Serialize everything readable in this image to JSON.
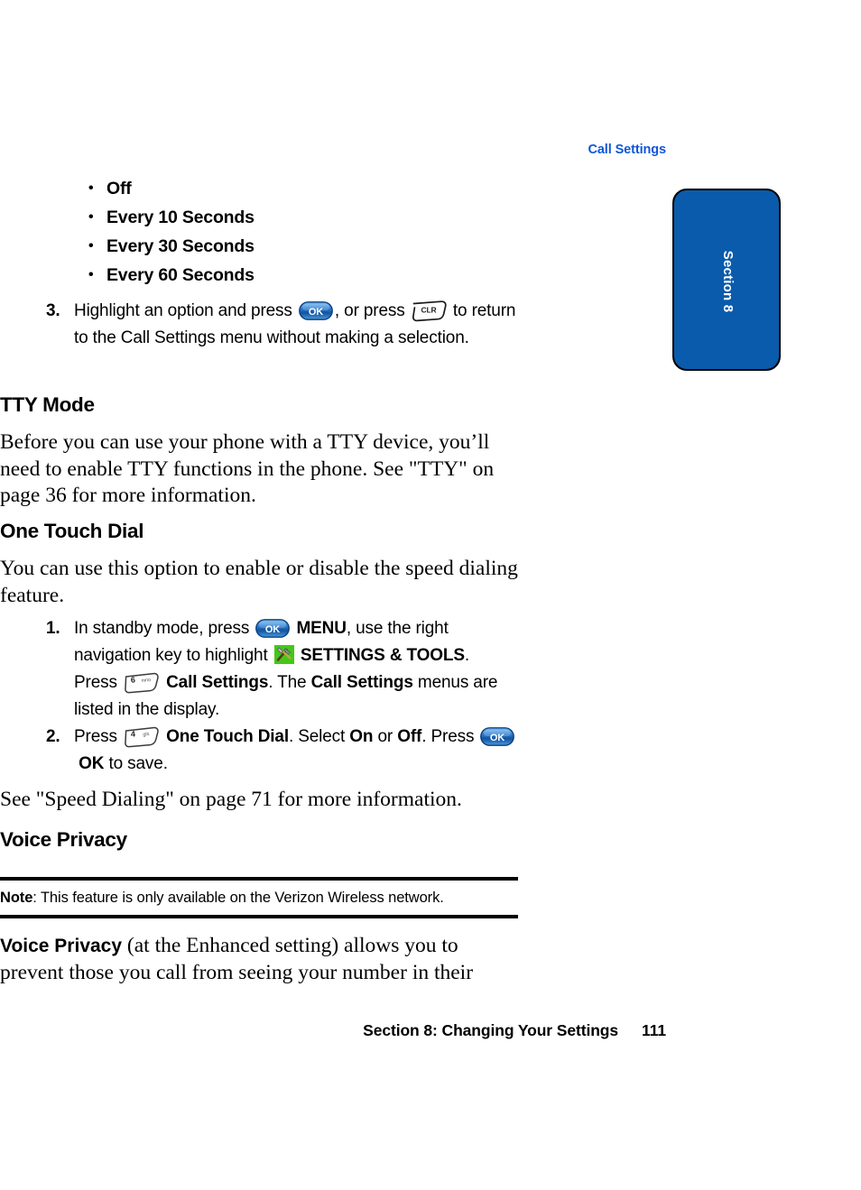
{
  "running_head": "Call Settings",
  "section_tab": {
    "label": "Section 8",
    "color": "#0a5bab"
  },
  "colors": {
    "running_head": "#0f56d8",
    "tab_blue": "#0a5bab",
    "ok_key_blue": "#1f6fd0",
    "tools_green": "#44c718"
  },
  "bullets": [
    "Off",
    "Every 10 Seconds",
    "Every 30 Seconds",
    "Every 60 Seconds"
  ],
  "step3": {
    "number": "3.",
    "t1": "Highlight an option and press",
    "t2": ", or press",
    "t3": "to return to the Call Settings menu without making a selection.",
    "ok_key_label": "OK",
    "clr_key_label": "CLR"
  },
  "tty": {
    "heading": "TTY Mode",
    "paragraph": "Before you can use your phone with a TTY device, you’ll need to enable TTY functions in the phone. See \"TTY\" on page 36 for more information."
  },
  "one_touch_dial": {
    "heading": "One Touch Dial",
    "paragraph": "You can use this option to enable or disable the speed dialing feature.",
    "step1": {
      "number": "1.",
      "t1": "In standby mode, press",
      "b1": "MENU",
      "t2": ", use the right navigation key to highlight",
      "b2": "SETTINGS & TOOLS",
      "t3": ". Press",
      "b3": "Call Settings",
      "t4": ". The",
      "b4": "Call Settings",
      "t5": "menus are listed in the display.",
      "ok_key_label": "OK",
      "num_key_digit": "6",
      "num_key_letters": "mno",
      "tools_icon_name": "settings-and-tools-icon"
    },
    "step2": {
      "number": "2.",
      "t1": "Press",
      "b1": "One Touch Dial",
      "t2": ". Select",
      "b2": "On",
      "t3": "or",
      "b3": "Off",
      "t4": ". Press",
      "b4": "OK",
      "t5": "to save.",
      "ok_key_label": "OK",
      "num_key_digit": "4",
      "num_key_letters": "ghi"
    },
    "see_also": "See \"Speed Dialing\" on page 71 for more information."
  },
  "voice_privacy": {
    "heading": "Voice Privacy",
    "note_label": "Note",
    "note_text": ": This feature is only available on the Verizon Wireless network.",
    "para_bold": "Voice Privacy",
    "para_rest": " (at the Enhanced setting) allows you to prevent those you call from seeing your number in their"
  },
  "footer": {
    "text": "Section 8: Changing Your Settings",
    "page_number": "111"
  }
}
